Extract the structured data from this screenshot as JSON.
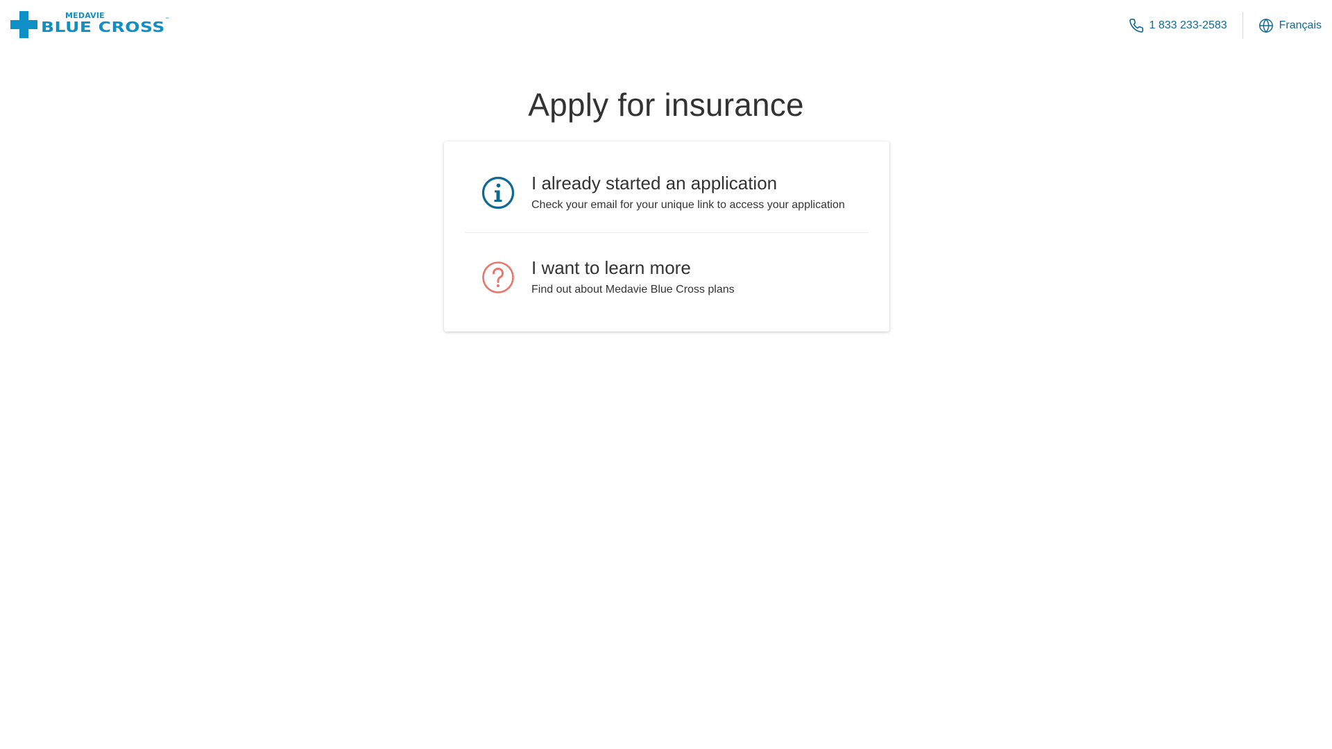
{
  "header": {
    "logo": {
      "small_text": "MEDAVIE",
      "big_text": "BLUE CROSS",
      "tm": "™"
    },
    "phone": {
      "icon": "phone-icon",
      "label": "1 833 233-2583"
    },
    "language": {
      "icon": "globe-icon",
      "label": "Français"
    }
  },
  "main": {
    "title": "Apply for insurance",
    "options": [
      {
        "icon": "info-circle-icon",
        "title": "I already started an application",
        "description": "Check your email for your unique link to access your application"
      },
      {
        "icon": "question-circle-icon",
        "title": "I want to learn more",
        "description": "Find out about Medavie Blue Cross plans"
      }
    ]
  },
  "colors": {
    "brand_blue": "#0e8fc5",
    "link_blue": "#0f6a93",
    "info_icon": "#0f6a93",
    "question_icon": "#e8776b",
    "text": "#333333"
  }
}
